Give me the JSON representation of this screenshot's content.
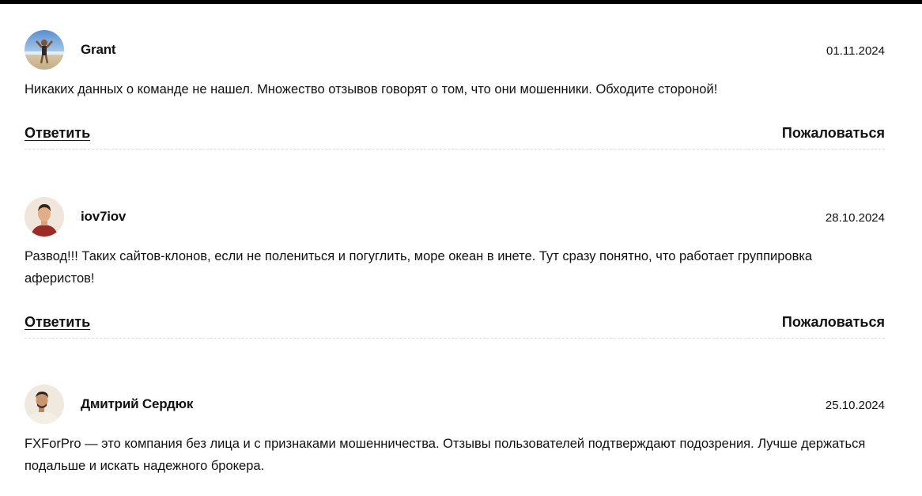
{
  "comments": [
    {
      "author": "Grant",
      "date": "01.11.2024",
      "text": "Никаких данных о команде не нашел. Множество отзывов говорят о том, что они мошенники. Обходите стороной!",
      "reply_label": "Ответить",
      "report_label": "Пожаловаться"
    },
    {
      "author": "iov7iov",
      "date": "28.10.2024",
      "text": "Развод!!! Таких сайтов-клонов, если не полениться и погуглить, море океан в инете. Тут сразу понятно, что работает группировка аферистов!",
      "reply_label": "Ответить",
      "report_label": "Пожаловаться"
    },
    {
      "author": "Дмитрий Сердюк",
      "date": "25.10.2024",
      "text": "FXForPro — это компания без лица и с признаками мошенничества. Отзывы пользователей подтверждают подозрения. Лучше держаться подальше и искать надежного брокера."
    }
  ]
}
